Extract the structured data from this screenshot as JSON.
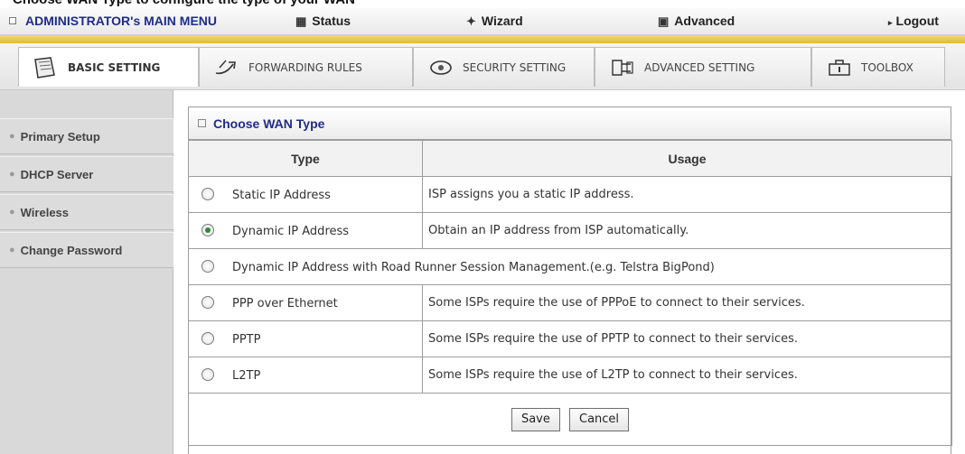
{
  "caption": "Choose WAN Type to configure the type of your WAN",
  "top_menu": {
    "admin": "ADMINISTRATOR's MAIN MENU",
    "status": "Status",
    "wizard": "Wizard",
    "advanced": "Advanced",
    "logout": "Logout"
  },
  "tabs": [
    {
      "label": "BASIC SETTING",
      "icon": "document-icon",
      "active": true
    },
    {
      "label": "FORWARDING RULES",
      "icon": "forward-arrows-icon",
      "active": false
    },
    {
      "label": "SECURITY SETTING",
      "icon": "security-eye-icon",
      "active": false
    },
    {
      "label": "ADVANCED SETTING",
      "icon": "network-icon",
      "active": false
    },
    {
      "label": "TOOLBOX",
      "icon": "toolbox-icon",
      "active": false
    }
  ],
  "sidebar": {
    "items": [
      {
        "label": "Primary Setup"
      },
      {
        "label": "DHCP Server"
      },
      {
        "label": "Wireless"
      },
      {
        "label": "Change Password"
      }
    ]
  },
  "panel": {
    "title": "Choose WAN Type",
    "col_type": "Type",
    "col_usage": "Usage",
    "rows": [
      {
        "type": "Static IP Address",
        "usage": "ISP assigns you a static IP address.",
        "selected": false
      },
      {
        "type": "Dynamic IP Address",
        "usage": "Obtain an IP address from ISP automatically.",
        "selected": true
      },
      {
        "type": "Dynamic IP Address with Road Runner Session Management.(e.g. Telstra BigPond)",
        "usage": "",
        "selected": false
      },
      {
        "type": "PPP over Ethernet",
        "usage": "Some ISPs require the use of PPPoE to connect to their services.",
        "selected": false
      },
      {
        "type": "PPTP",
        "usage": "Some ISPs require the use of PPTP to connect to their services.",
        "selected": false
      },
      {
        "type": "L2TP",
        "usage": "Some ISPs require the use of L2TP to connect to their services.",
        "selected": false
      }
    ],
    "save_label": "Save",
    "cancel_label": "Cancel"
  },
  "colors": {
    "accent_blue": "#1f2c8a",
    "gold_stripe": "#e2b93a",
    "selected_radio": "#2d8a30"
  }
}
